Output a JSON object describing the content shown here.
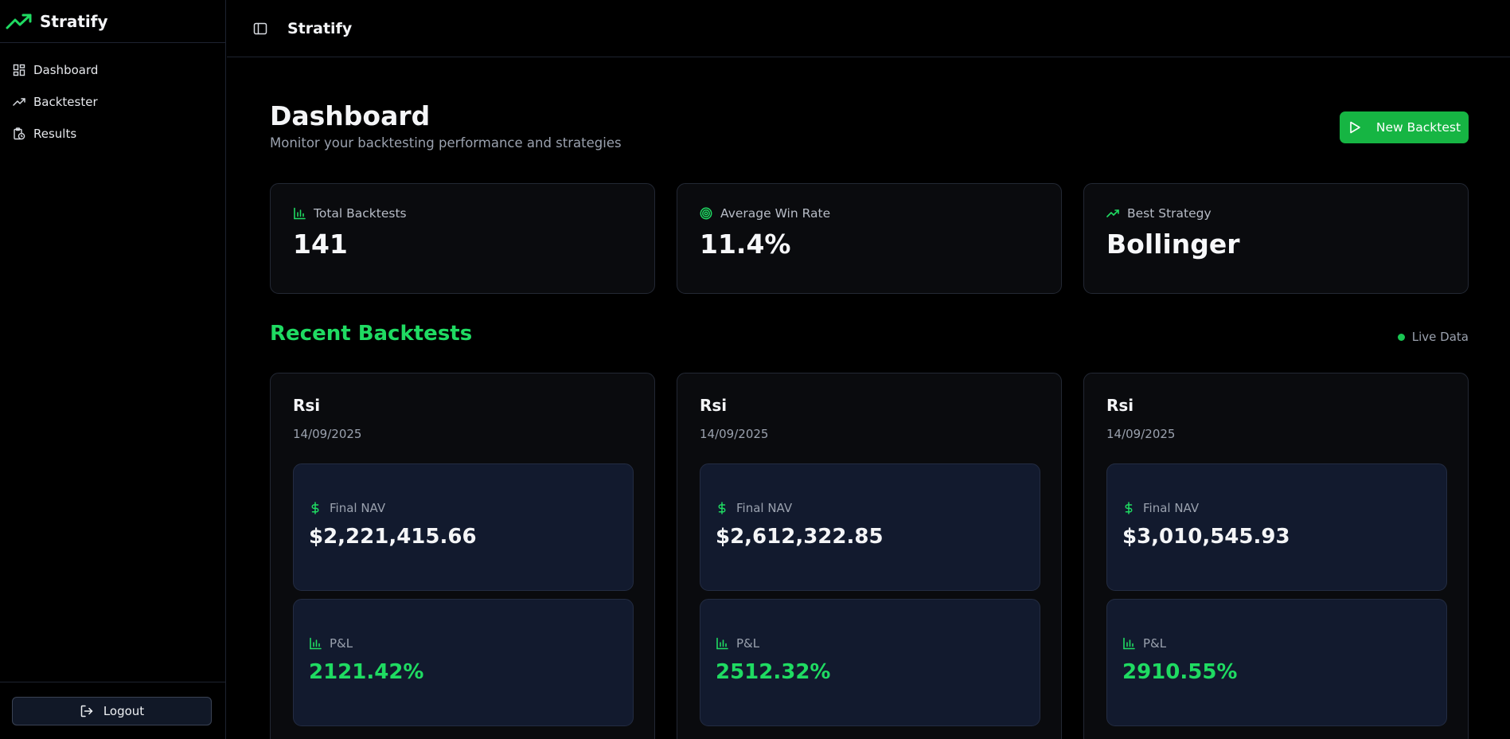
{
  "colors": {
    "accent": "#1fdb62",
    "button": "#16b543",
    "background": "#000000",
    "card": "#0a0b0e",
    "metric_card": "#121a2e"
  },
  "sidebar": {
    "brand": "Stratify",
    "items": [
      {
        "label": "Dashboard",
        "icon": "dashboard-grid-icon"
      },
      {
        "label": "Backtester",
        "icon": "trending-up-icon"
      },
      {
        "label": "Results",
        "icon": "clipboard-clock-icon"
      }
    ],
    "logout_label": "Logout"
  },
  "header": {
    "title": "Stratify"
  },
  "main": {
    "title": "Dashboard",
    "subtitle": "Monitor your backtesting performance and strategies",
    "new_backtest_label": "New Backtest",
    "stats": [
      {
        "label": "Total Backtests",
        "value": "141",
        "icon": "bar-chart-icon"
      },
      {
        "label": "Average Win Rate",
        "value": "11.4%",
        "icon": "target-icon"
      },
      {
        "label": "Best Strategy",
        "value": "Bollinger",
        "icon": "trending-up-icon"
      }
    ],
    "recent_title": "Recent Backtests",
    "live_label": "Live Data",
    "backtests": [
      {
        "name": "Rsi",
        "date": "14/09/2025",
        "nav_label": "Final NAV",
        "nav": "$2,221,415.66",
        "pnl_label": "P&L",
        "pnl": "2121.42%"
      },
      {
        "name": "Rsi",
        "date": "14/09/2025",
        "nav_label": "Final NAV",
        "nav": "$2,612,322.85",
        "pnl_label": "P&L",
        "pnl": "2512.32%"
      },
      {
        "name": "Rsi",
        "date": "14/09/2025",
        "nav_label": "Final NAV",
        "nav": "$3,010,545.93",
        "pnl_label": "P&L",
        "pnl": "2910.55%"
      }
    ]
  }
}
